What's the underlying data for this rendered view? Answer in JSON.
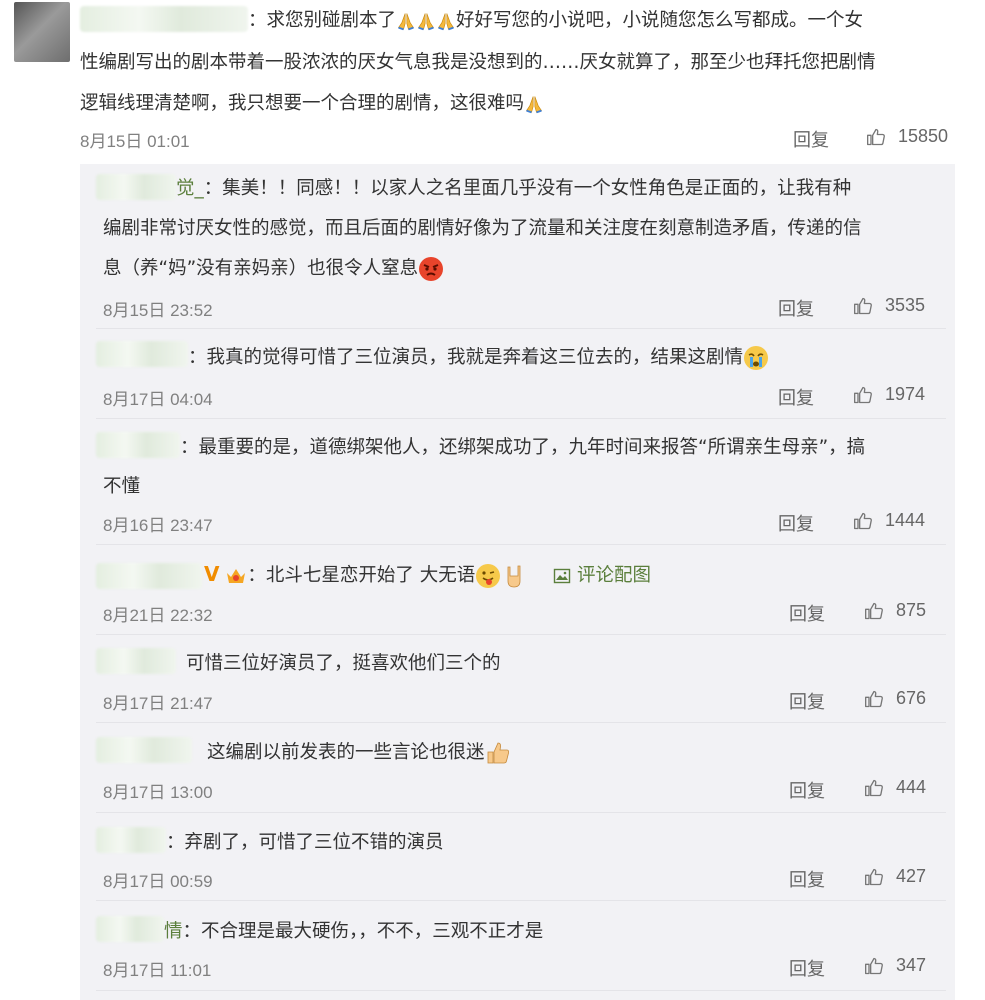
{
  "main_comment": {
    "text_1": "：求您别碰剧本了",
    "text_2": "好好写您的小说吧，小说随您怎么写都成。一个女",
    "text_3": "性编剧写出的剧本带着一股浓浓的厌女气息我是没想到的……厌女就算了，那至少也拜托您把剧情",
    "text_4": "逻辑线理清楚啊，我只想要一个合理的剧情，这很难吗",
    "time": "8月15日 01:01",
    "reply_label": "回复",
    "likes": "15850"
  },
  "replies": [
    {
      "name_tail": "觉_",
      "line_1": "：集美！！同感！！以家人之名里面几乎没有一个女性角色是正面的，让我有种",
      "line_2": "编剧非常讨厌女性的感觉，而且后面的剧情好像为了流量和关注度在刻意制造矛盾，传递的信",
      "line_3": "息（养“妈”没有亲妈亲）也很令人窒息",
      "time": "8月15日 23:52",
      "reply_label": "回复",
      "likes": "3535"
    },
    {
      "line_1": "：我真的觉得可惜了三位演员，我就是奔着这三位去的，结果这剧情",
      "time": "8月17日 04:04",
      "reply_label": "回复",
      "likes": "1974"
    },
    {
      "line_1": "：最重要的是，道德绑架他人，还绑架成功了，九年时间来报答“所谓亲生母亲”，搞",
      "line_2": "不懂",
      "time": "8月16日 23:47",
      "reply_label": "回复",
      "likes": "1444"
    },
    {
      "line_1": "：北斗七星恋开始了 大无语",
      "pic_link": "评论配图",
      "time": "8月21日 22:32",
      "reply_label": "回复",
      "likes": "875"
    },
    {
      "line_1": "可惜三位好演员了，挺喜欢他们三个的",
      "time": "8月17日 21:47",
      "reply_label": "回复",
      "likes": "676"
    },
    {
      "line_1": "这编剧以前发表的一些言论也很迷",
      "time": "8月17日 13:00",
      "reply_label": "回复",
      "likes": "444"
    },
    {
      "line_1": "：弃剧了，可惜了三位不错的演员",
      "time": "8月17日 00:59",
      "reply_label": "回复",
      "likes": "427"
    },
    {
      "name_tail": "情",
      "line_1": "：不合理是最大硬伤，，不不，三观不正才是",
      "time": "8月17日 11:01",
      "reply_label": "回复",
      "likes": "347"
    }
  ],
  "icons": {
    "pray": "pray-emoji-icon",
    "angry": "angry-emoji-icon",
    "cry": "crying-emoji-icon",
    "tongue": "tongue-out-emoji-icon",
    "rock": "rock-hand-emoji-icon",
    "thumbs_up": "thumbs-up-emoji-icon",
    "like": "like-thumb-icon",
    "picture": "picture-icon",
    "vip": "vip-badge-icon"
  },
  "colors": {
    "link_green": "#5b7f3c",
    "text": "#333333",
    "muted": "#808080",
    "panel": "#f2f2f5"
  }
}
